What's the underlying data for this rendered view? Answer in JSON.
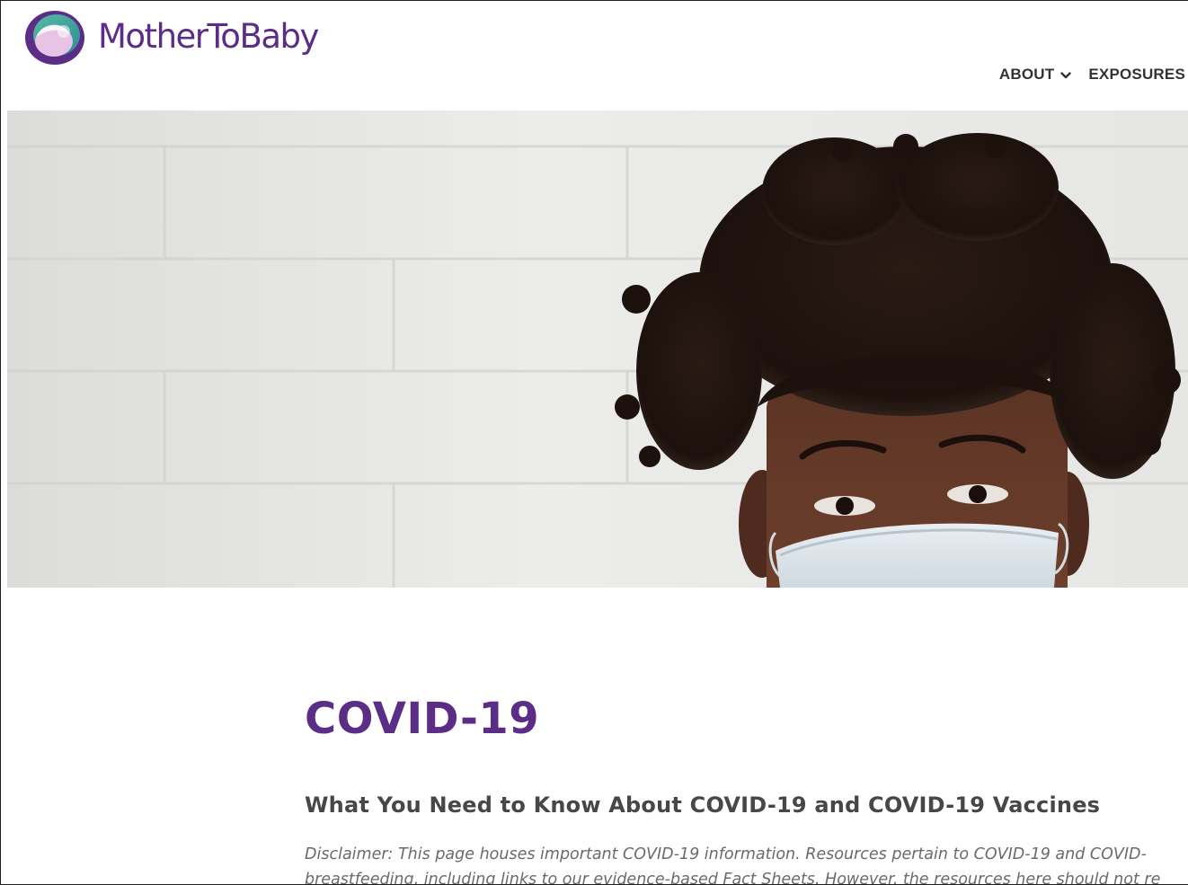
{
  "brand": {
    "name": "MotherToBaby",
    "logo_icon": "mothertobaby-logo-icon",
    "colors": {
      "purple": "#5b2d86",
      "teal": "#4aa79a",
      "lavender": "#e2bfe2"
    }
  },
  "nav": {
    "items": [
      {
        "label": "ABOUT",
        "has_dropdown": true,
        "icon": "chevron-down-icon"
      },
      {
        "label": "EXPOSURES",
        "has_dropdown": false
      }
    ]
  },
  "hero": {
    "image": "woman-wearing-face-mask-photo"
  },
  "main": {
    "title": "COVID-19",
    "subtitle": "What You Need to Know About COVID-19 and COVID-19 Vaccines",
    "disclaimer_line1": "Disclaimer: This page houses important COVID-19 information. Resources pertain to COVID-19 and COVID-",
    "disclaimer_line2": "breastfeeding, including links to our evidence-based Fact Sheets. However, the resources here should not re"
  }
}
